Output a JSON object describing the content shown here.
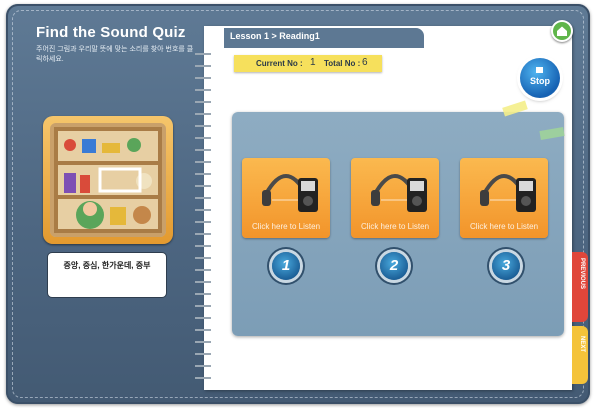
{
  "quiz": {
    "title": "Find the Sound Quiz",
    "instruction": "주어진 그림과 우리말 뜻에 맞는 소리를 찾아 번호를 클릭하세요.",
    "answer_text": "중앙, 중심, 한가운데, 중부"
  },
  "lesson": {
    "breadcrumb": "Lesson 1 > Reading1"
  },
  "counter": {
    "current_label": "Current No :",
    "current_value": "1",
    "total_label": "Total No :",
    "total_value": "6"
  },
  "controls": {
    "stop_label": "Stop",
    "home_icon": "home-icon"
  },
  "choices": [
    {
      "label": "Click here to Listen",
      "number": "1"
    },
    {
      "label": "Click here to Listen",
      "number": "2"
    },
    {
      "label": "Click here to Listen",
      "number": "3"
    }
  ],
  "nav": {
    "previous_label": "PREVIOUS",
    "next_label": "NEXT"
  },
  "colors": {
    "frame": "#4c6580",
    "tab": "#5d7893",
    "accent_orange": "#f2942a",
    "counter_yellow": "#f6e05c",
    "stop_blue": "#1662b3",
    "prev_red": "#e0463a",
    "next_yellow": "#f4c33a"
  }
}
